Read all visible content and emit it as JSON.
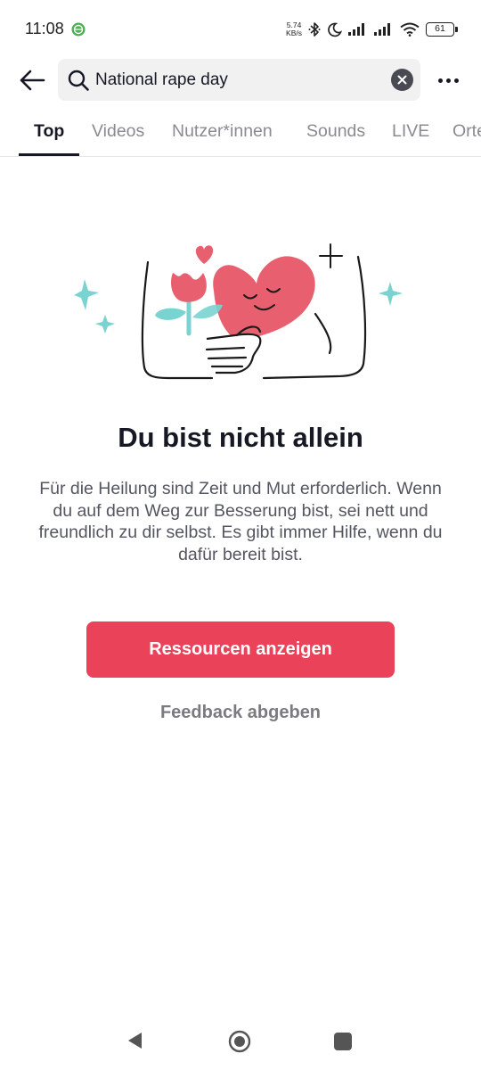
{
  "status_bar": {
    "time": "11:08",
    "net_speed_value": "5.74",
    "net_speed_unit": "KB/s",
    "battery": "61",
    "icons": [
      "app-notification-icon",
      "bluetooth-icon",
      "do-not-disturb-moon-icon",
      "signal-icon",
      "signal-icon",
      "wifi-icon",
      "battery-icon"
    ]
  },
  "header": {
    "search_value": "National rape day",
    "icons": [
      "back-arrow-icon",
      "search-icon",
      "clear-icon",
      "more-icon"
    ]
  },
  "tabs": [
    {
      "label": "Top",
      "active": true
    },
    {
      "label": "Videos"
    },
    {
      "label": "Nutzer*innen"
    },
    {
      "label": "Sounds"
    },
    {
      "label": "LIVE"
    },
    {
      "label": "Orte"
    }
  ],
  "content": {
    "title": "Du bist nicht allein",
    "description": "Für die Heilung sind Zeit und Mut erforderlich. Wenn du auf dem Weg zur Besserung bist, sei nett und freundlich zu dir selbst. Es gibt immer Hilfe, wenn du dafür bereit bist.",
    "primary_button": "Ressourcen anzeigen",
    "feedback_link": "Feedback abgeben"
  },
  "colors": {
    "accent": "#ea4359",
    "heart": "#e8606f",
    "teal": "#79d3d0",
    "text": "#161823",
    "muted": "#8a8b91"
  },
  "navigation_bar": {
    "icons": [
      "nav-back-icon",
      "nav-home-icon",
      "nav-recents-icon"
    ]
  }
}
